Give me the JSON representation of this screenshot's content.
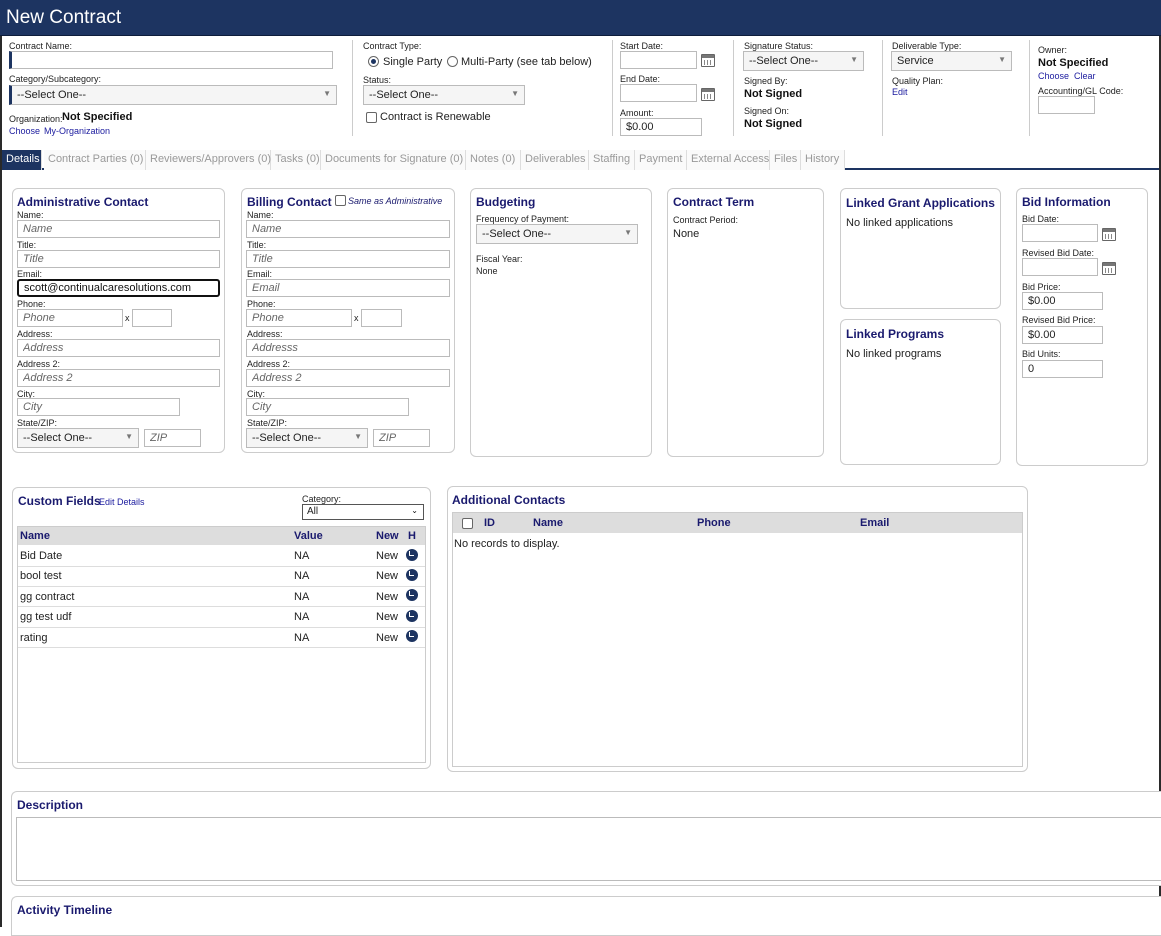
{
  "window": {
    "title": "New Contract"
  },
  "header": {
    "contract_name_label": "Contract Name:",
    "category_label": "Category/Subcategory:",
    "category_value": "--Select One--",
    "organization_label": "Organization:",
    "organization_value": "Not Specified",
    "org_choose": "Choose",
    "org_my": "My-Organization",
    "contract_type_label": "Contract Type:",
    "single_party": "Single Party",
    "multi_party": "Multi-Party (see tab below)",
    "status_label": "Status:",
    "status_value": "--Select One--",
    "renewable_label": "Contract is Renewable",
    "start_date_label": "Start Date:",
    "end_date_label": "End Date:",
    "amount_label": "Amount:",
    "amount_value": "$0.00",
    "signature_status_label": "Signature Status:",
    "signature_status_value": "--Select One--",
    "signed_by_label": "Signed By:",
    "signed_by_value": "Not Signed",
    "signed_on_label": "Signed On:",
    "signed_on_value": "Not Signed",
    "deliverable_type_label": "Deliverable Type:",
    "deliverable_type_value": "Service",
    "quality_plan_label": "Quality Plan:",
    "quality_plan_edit": "Edit",
    "owner_label": "Owner:",
    "owner_value": "Not Specified",
    "owner_choose": "Choose",
    "owner_clear": "Clear",
    "gl_code_label": "Accounting/GL Code:"
  },
  "tabs": [
    "Details",
    "Contract Parties (0)",
    "Reviewers/Approvers (0)",
    "Tasks (0)",
    "Documents for Signature (0)",
    "Notes (0)",
    "Deliverables",
    "Staffing",
    "Payment",
    "External Access",
    "Files",
    "History"
  ],
  "admin_contact": {
    "title": "Administrative Contact",
    "name_label": "Name:",
    "name_ph": "Name",
    "title_label": "Title:",
    "title_ph": "Title",
    "email_label": "Email:",
    "email_value": "scott@continualcaresolutions.com",
    "phone_label": "Phone:",
    "phone_ph": "Phone",
    "x": "x",
    "address_label": "Address:",
    "address_ph": "Address",
    "address2_label": "Address 2:",
    "address2_ph": "Address 2",
    "city_label": "City:",
    "city_ph": "City",
    "state_label": "State/ZIP:",
    "state_value": "--Select One--",
    "zip_ph": "ZIP"
  },
  "billing_contact": {
    "title": "Billing Contact",
    "same_as": "Same as Administrative",
    "name_label": "Name:",
    "name_ph": "Name",
    "title_label": "Title:",
    "title_ph": "Title",
    "email_label": "Email:",
    "email_ph": "Email",
    "phone_label": "Phone:",
    "phone_ph": "Phone",
    "x": "x",
    "address_label": "Address:",
    "address_ph": "Addresss",
    "address2_label": "Address 2:",
    "address2_ph": "Address 2",
    "city_label": "City:",
    "city_ph": "City",
    "state_label": "State/ZIP:",
    "state_value": "--Select One--",
    "zip_ph": "ZIP"
  },
  "budgeting": {
    "title": "Budgeting",
    "freq_label": "Frequency of Payment:",
    "freq_value": "--Select One--",
    "fiscal_label": "Fiscal Year:",
    "fiscal_value": "None"
  },
  "contract_term": {
    "title": "Contract Term",
    "period_label": "Contract Period:",
    "period_value": "None"
  },
  "linked_grants": {
    "title": "Linked Grant Applications",
    "empty": "No linked applications"
  },
  "linked_programs": {
    "title": "Linked Programs",
    "empty": "No linked programs"
  },
  "bid_info": {
    "title": "Bid Information",
    "bid_date_label": "Bid Date:",
    "revised_bid_date_label": "Revised Bid Date:",
    "bid_price_label": "Bid Price:",
    "bid_price_value": "$0.00",
    "revised_bid_price_label": "Revised Bid Price:",
    "revised_bid_price_value": "$0.00",
    "bid_units_label": "Bid Units:",
    "bid_units_value": "0"
  },
  "custom_fields": {
    "title": "Custom Fields",
    "edit_link": "Edit Details",
    "category_label": "Category:",
    "category_value": "All",
    "columns": [
      "Name",
      "Value",
      "New",
      "H"
    ],
    "rows": [
      {
        "name": "Bid Date",
        "value": "NA",
        "new": "New"
      },
      {
        "name": "bool test",
        "value": "NA",
        "new": "New"
      },
      {
        "name": "gg contract",
        "value": "NA",
        "new": "New"
      },
      {
        "name": "gg test udf",
        "value": "NA",
        "new": "New"
      },
      {
        "name": "rating",
        "value": "NA",
        "new": "New"
      }
    ]
  },
  "additional_contacts": {
    "title": "Additional Contacts",
    "columns": [
      "ID",
      "Name",
      "Phone",
      "Email"
    ],
    "empty": "No records to display."
  },
  "description": {
    "title": "Description"
  },
  "activity": {
    "title": "Activity Timeline"
  }
}
